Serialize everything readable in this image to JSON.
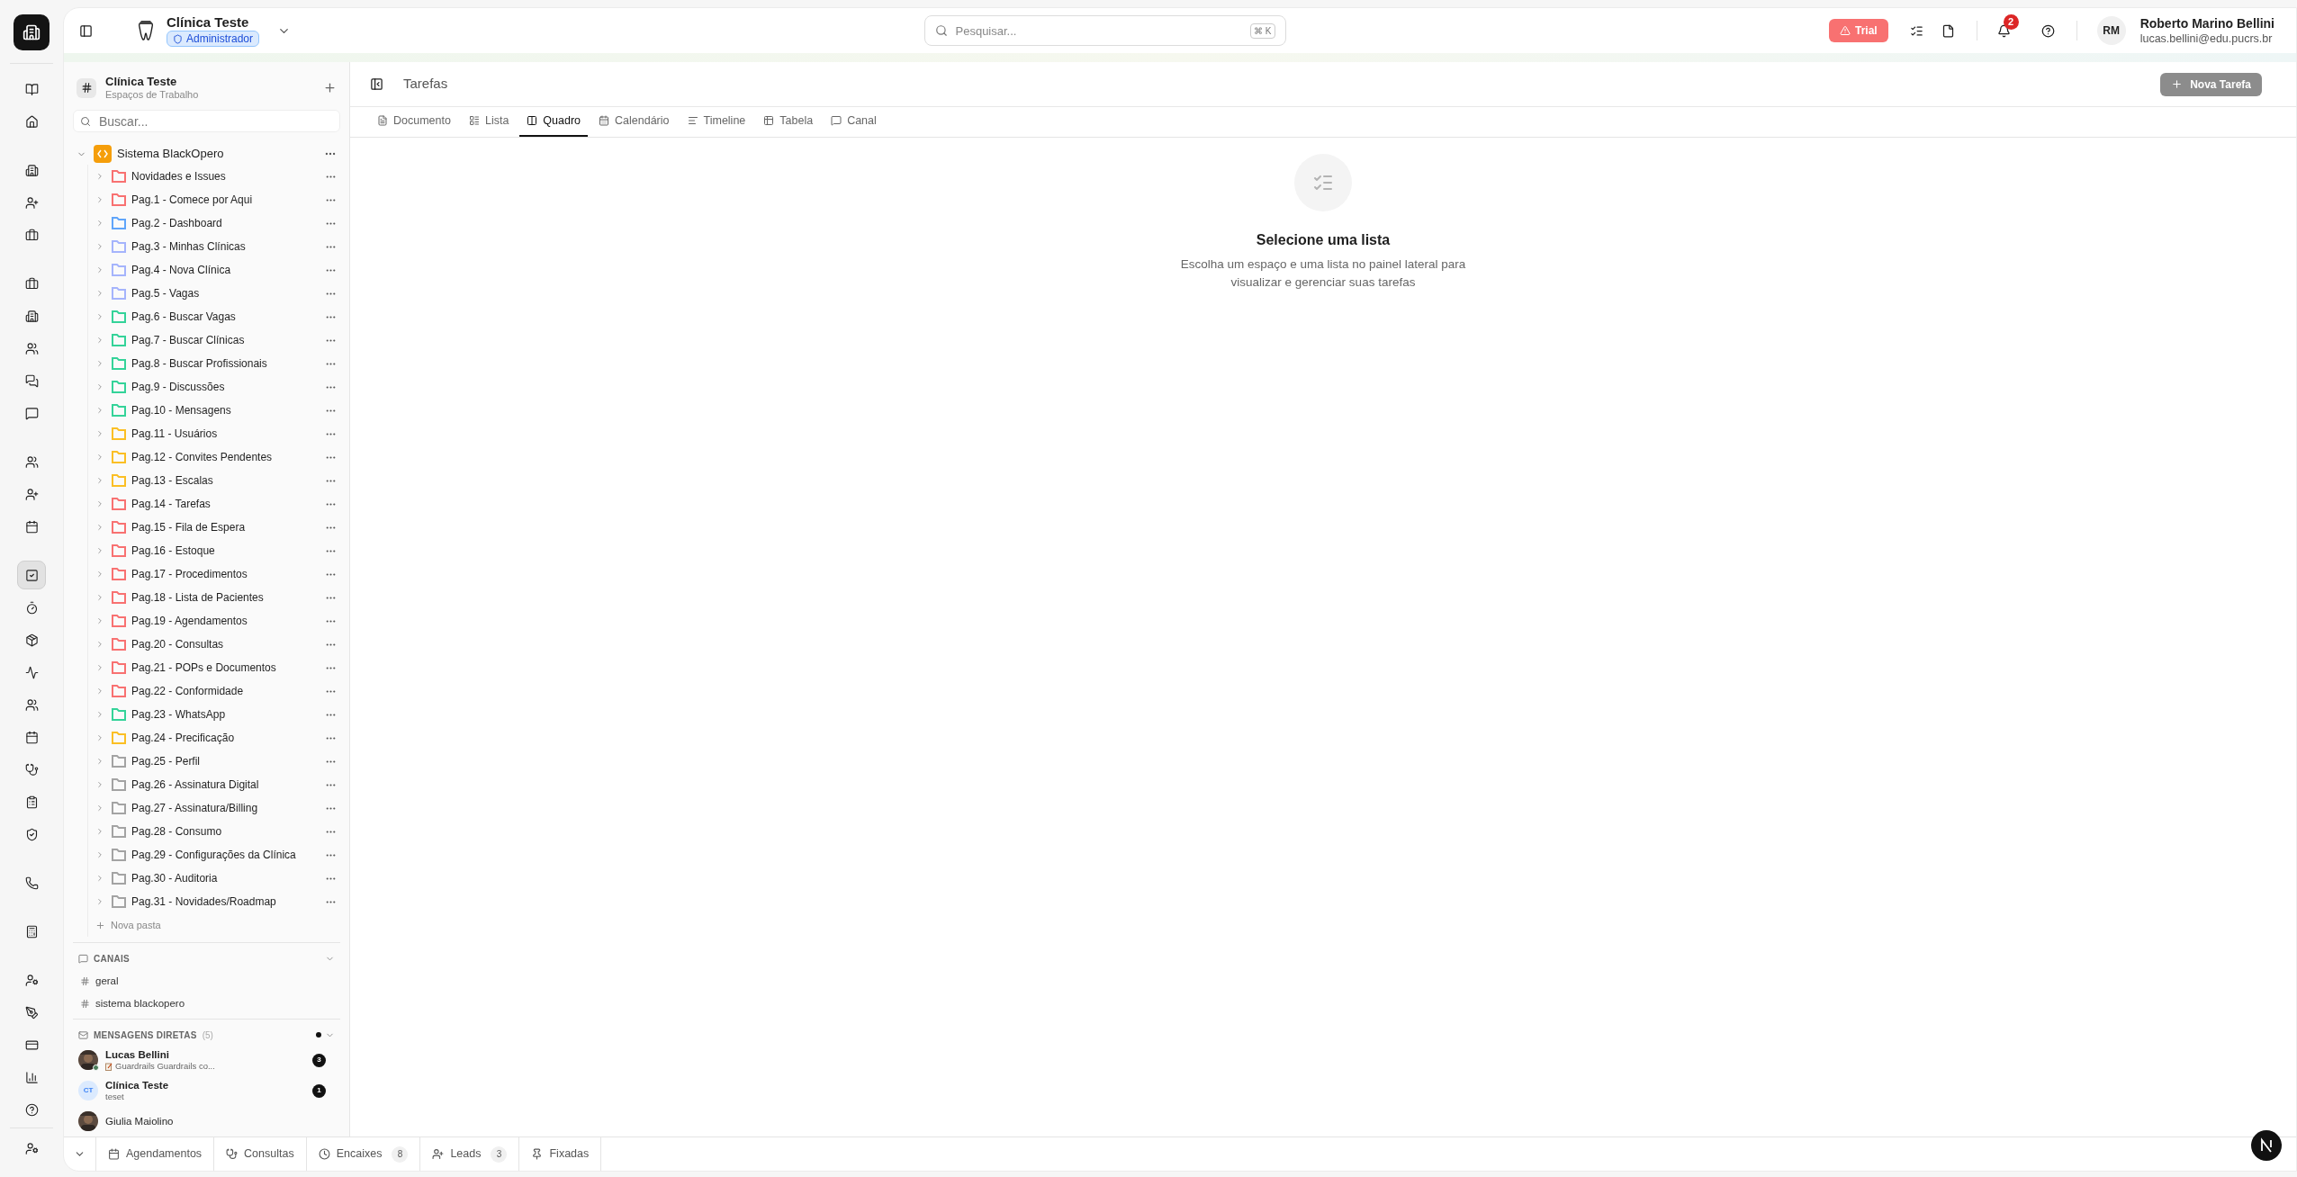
{
  "rail": {
    "groups": [
      [
        {
          "selected": false
        },
        {
          "selected": false
        }
      ],
      [
        {
          "selected": false
        },
        {
          "selected": false
        },
        {
          "selected": false
        }
      ],
      [
        {
          "selected": false
        },
        {
          "selected": false
        },
        {
          "selected": false
        },
        {
          "selected": false
        },
        {
          "selected": false
        }
      ],
      [
        {
          "selected": false
        },
        {
          "selected": false
        },
        {
          "selected": false
        }
      ],
      [
        {
          "selected": true
        },
        {
          "selected": false
        },
        {
          "selected": false
        },
        {
          "selected": false
        },
        {
          "selected": false
        },
        {
          "selected": false
        },
        {
          "selected": false
        },
        {
          "selected": false
        },
        {
          "selected": false
        }
      ],
      [
        {
          "selected": false
        }
      ],
      [
        {
          "selected": false
        }
      ],
      [
        {
          "selected": false
        },
        {
          "selected": false
        },
        {
          "selected": false
        },
        {
          "selected": false
        },
        {
          "selected": false
        }
      ]
    ]
  },
  "header": {
    "workspace": "Clínica Teste",
    "role": "Administrador"
  },
  "search": {
    "placeholder": "Pesquisar...",
    "keys": [
      "⌘",
      "K"
    ]
  },
  "trial": "Trial",
  "notifications": "2",
  "user": {
    "initials": "RM",
    "name": "Roberto Marino Bellini",
    "email": "lucas.bellini@edu.pucrs.br"
  },
  "sidebar": {
    "title": "Clínica Teste",
    "subtitle": "Espaços de Trabalho",
    "search_placeholder": "Buscar...",
    "tree": {
      "label": "Sistema BlackOpero",
      "expanded": true,
      "children": [
        {
          "label": "Novidades e Issues",
          "color": "#f87171",
          "expanded": false
        },
        {
          "label": "Pag.1 - Comece por Aqui",
          "color": "#f87171",
          "expanded": false
        },
        {
          "label": "Pag.2 - Dashboard",
          "color": "#60a5fa",
          "expanded": false
        },
        {
          "label": "Pag.3 - Minhas Clínicas",
          "color": "#a5b4fc",
          "expanded": false
        },
        {
          "label": "Pag.4 - Nova Clínica",
          "color": "#a5b4fc",
          "expanded": false
        },
        {
          "label": "Pag.5 - Vagas",
          "color": "#a5b4fc",
          "expanded": false
        },
        {
          "label": "Pag.6 - Buscar Vagas",
          "color": "#34d399",
          "expanded": false
        },
        {
          "label": "Pag.7 - Buscar Clínicas",
          "color": "#34d399",
          "expanded": false
        },
        {
          "label": "Pag.8 - Buscar Profissionais",
          "color": "#34d399",
          "expanded": false
        },
        {
          "label": "Pag.9 - Discussões",
          "color": "#34d399",
          "expanded": false
        },
        {
          "label": "Pag.10 - Mensagens",
          "color": "#34d399",
          "expanded": false
        },
        {
          "label": "Pag.11 - Usuários",
          "color": "#fbbf24",
          "expanded": false
        },
        {
          "label": "Pag.12 - Convites Pendentes",
          "color": "#fbbf24",
          "expanded": false
        },
        {
          "label": "Pag.13 - Escalas",
          "color": "#fbbf24",
          "expanded": false
        },
        {
          "label": "Pag.14 - Tarefas",
          "color": "#f87171",
          "expanded": false
        },
        {
          "label": "Pag.15 - Fila de Espera",
          "color": "#f87171",
          "expanded": false
        },
        {
          "label": "Pag.16 - Estoque",
          "color": "#f87171",
          "expanded": false
        },
        {
          "label": "Pag.17 - Procedimentos",
          "color": "#f87171",
          "expanded": false
        },
        {
          "label": "Pag.18 - Lista de Pacientes",
          "color": "#f87171",
          "expanded": false
        },
        {
          "label": "Pag.19 - Agendamentos",
          "color": "#f87171",
          "expanded": false
        },
        {
          "label": "Pag.20 - Consultas",
          "color": "#f87171",
          "expanded": false
        },
        {
          "label": "Pag.21 - POPs e Documentos",
          "color": "#f87171",
          "expanded": false
        },
        {
          "label": "Pag.22 - Conformidade",
          "color": "#f87171",
          "expanded": false
        },
        {
          "label": "Pag.23 - WhatsApp",
          "color": "#34d399",
          "expanded": false
        },
        {
          "label": "Pag.24 - Precificação",
          "color": "#fbbf24",
          "expanded": false
        },
        {
          "label": "Pag.25 - Perfil",
          "color": "#a3a3a3",
          "expanded": false
        },
        {
          "label": "Pag.26 - Assinatura Digital",
          "color": "#a3a3a3",
          "expanded": false
        },
        {
          "label": "Pag.27 - Assinatura/Billing",
          "color": "#a3a3a3",
          "expanded": false
        },
        {
          "label": "Pag.28 - Consumo",
          "color": "#a3a3a3",
          "expanded": false
        },
        {
          "label": "Pag.29 - Configurações da Clínica",
          "color": "#a3a3a3",
          "expanded": false
        },
        {
          "label": "Pag.30 - Auditoria",
          "color": "#a3a3a3",
          "expanded": false
        },
        {
          "label": "Pag.31 - Novidades/Roadmap",
          "color": "#a3a3a3",
          "expanded": false
        }
      ]
    },
    "new_folder": "Nova pasta",
    "channels": {
      "title": "CANAIS",
      "expanded": true,
      "items": [
        "geral",
        "sistema blackopero"
      ]
    },
    "direct": {
      "title": "MENSAGENS DIRETAS",
      "count": "(5)",
      "expanded": true,
      "items": [
        {
          "name": "Lucas Bellini",
          "preview": "Guardrails Guardrails co...",
          "unread": "3",
          "online": true
        },
        {
          "kind": "initials",
          "initials": "CT",
          "name": "Clínica Teste",
          "preview": "teset",
          "unread": "1",
          "online": false
        },
        {
          "name": "Giulia Maiolino",
          "online": false
        }
      ]
    }
  },
  "content": {
    "title": "Tarefas",
    "new_task": "Nova Tarefa",
    "tabs": [
      {
        "label": "Documento",
        "selected": false
      },
      {
        "label": "Lista",
        "selected": false
      },
      {
        "label": "Quadro",
        "selected": true
      },
      {
        "label": "Calendário",
        "selected": false
      },
      {
        "label": "Timeline",
        "selected": false
      },
      {
        "label": "Tabela",
        "selected": false
      },
      {
        "label": "Canal",
        "selected": false
      }
    ],
    "empty": {
      "title": "Selecione uma lista",
      "text": "Escolha um espaço e uma lista no painel lateral para visualizar e gerenciar suas tarefas"
    }
  },
  "bottom_bar": {
    "items": [
      {
        "label": "Agendamentos"
      },
      {
        "label": "Consultas"
      },
      {
        "label": "Encaixes",
        "count": "8"
      },
      {
        "label": "Leads",
        "count": "3"
      },
      {
        "label": "Fixadas"
      }
    ]
  }
}
